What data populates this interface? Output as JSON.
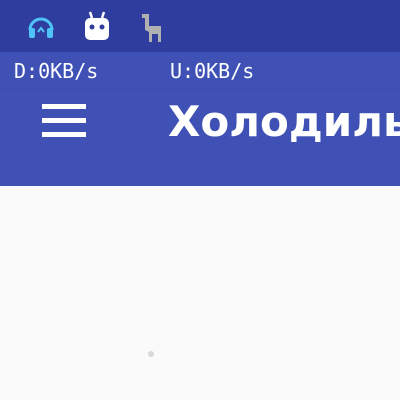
{
  "status_bar": {
    "icons": [
      "headphones-icon",
      "android-robot-icon",
      "llama-icon"
    ],
    "colors": {
      "headphones": "#4fc3f7",
      "robot": "#ffffff",
      "llama": "#b0b0b0"
    }
  },
  "network_speed": {
    "download": "D:0KB/s",
    "upload": "U:0KB/s"
  },
  "toolbar": {
    "menu_icon": "menu-icon",
    "title": "Холодильн"
  },
  "colors": {
    "status_bar": "#2f3e9e",
    "primary": "#3f51b5",
    "background": "#fafafa"
  }
}
